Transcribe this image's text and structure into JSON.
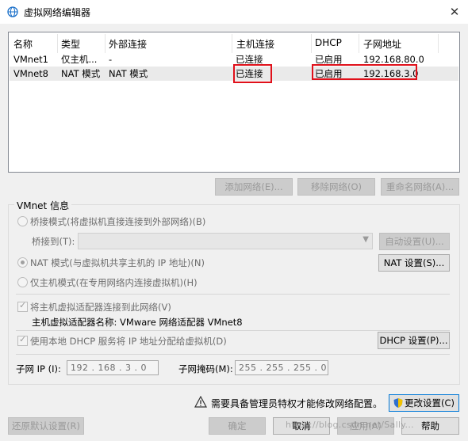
{
  "window": {
    "title": "虚拟网络编辑器",
    "close_glyph": "✕"
  },
  "network_table": {
    "columns": [
      "名称",
      "类型",
      "外部连接",
      "主机连接",
      "DHCP",
      "子网地址"
    ],
    "rows": [
      [
        "VMnet1",
        "仅主机...",
        "-",
        "已连接",
        "已启用",
        "192.168.80.0"
      ],
      [
        "VMnet8",
        "NAT 模式",
        "NAT 模式",
        "已连接",
        "已启用",
        "192.168.3.0"
      ]
    ],
    "highlight_color": "#e0101a"
  },
  "table_buttons": {
    "add": "添加网络(E)...",
    "remove": "移除网络(O)",
    "rename": "重命名网络(A)..."
  },
  "vmnet_info": {
    "group_label": "VMnet 信息",
    "bridged_label": "桥接模式(将虚拟机直接连接到外部网络)(B)",
    "bridged_to_label": "桥接到(T):",
    "bridged_to_value": "",
    "auto_settings": "自动设置(U)...",
    "nat_label": "NAT 模式(与虚拟机共享主机的 IP 地址)(N)",
    "nat_settings": "NAT 设置(S)...",
    "host_only_label": "仅主机模式(在专用网络内连接虚拟机)(H)",
    "connect_adapter_label": "将主机虚拟适配器连接到此网络(V)",
    "adapter_name_label": "主机虚拟适配器名称: VMware 网络适配器 VMnet8",
    "use_dhcp_label": "使用本地 DHCP 服务将 IP 地址分配给虚拟机(D)",
    "dhcp_settings": "DHCP 设置(P)...",
    "subnet_ip_label": "子网 IP (I):",
    "subnet_ip_value": "192 . 168 .  3  .  0",
    "subnet_mask_label": "子网掩码(M):",
    "subnet_mask_value": "255 . 255 . 255 .  0"
  },
  "admin_notice": {
    "text": "需要具备管理员特权才能修改网络配置。",
    "change_settings": "更改设置(C)"
  },
  "footer": {
    "restore_defaults": "还原默认设置(R)",
    "ok": "确定",
    "cancel": "取消",
    "apply": "应用(A)",
    "help": "帮助"
  },
  "watermark": "https://blog.csdn.net/Sally..."
}
